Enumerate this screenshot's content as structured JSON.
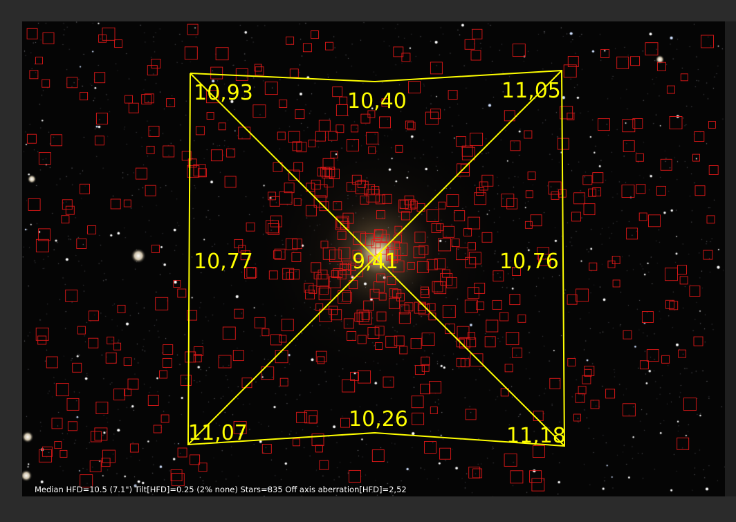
{
  "viewer": {
    "region_labels": {
      "top_left": "10,93",
      "top_center": "10,40",
      "top_right": "11,05",
      "middle_left": "10,77",
      "center": "9,41",
      "middle_right": "10,76",
      "bottom_left": "11,07",
      "bottom_center": "10,26",
      "bottom_right": "11,18"
    },
    "colors": {
      "overlay": "#ffff00",
      "star_box": "#e01818",
      "star_label": "#f2f200",
      "background": "#050505"
    }
  },
  "statusbar": {
    "text": "Median HFD=10.5 (7.1\")  Tilt[HFD]=0.25 (2% none)  Stars=835  Off axis aberration[HFD]=2,52"
  }
}
